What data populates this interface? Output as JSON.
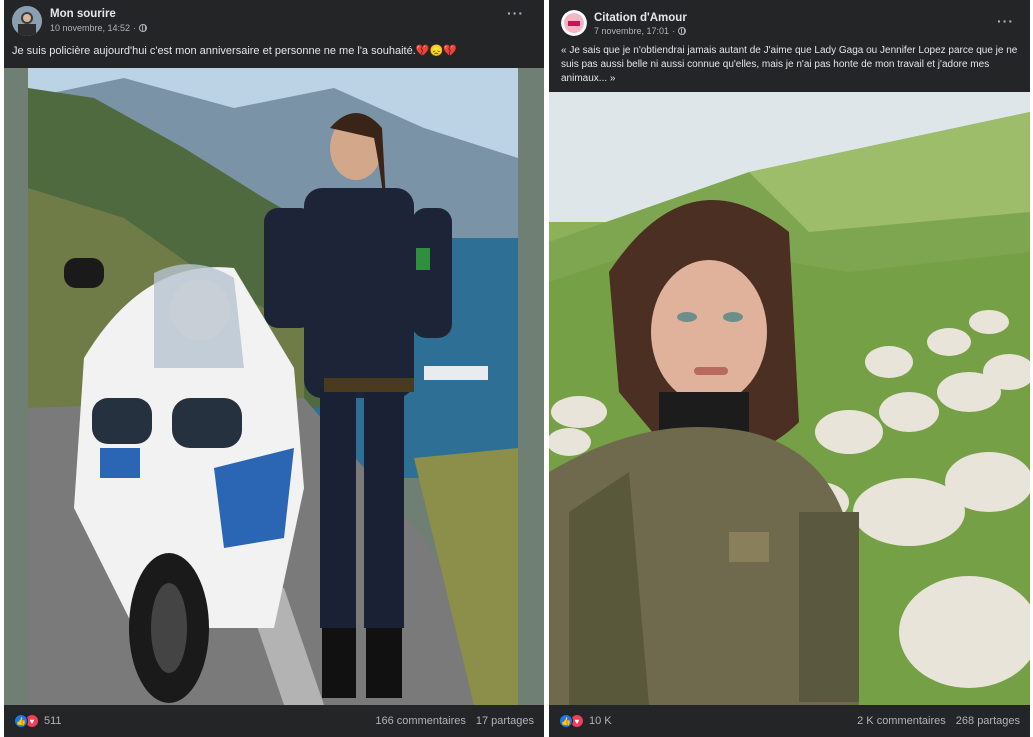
{
  "posts": [
    {
      "author": "Mon sourire",
      "date": "10 novembre, 14:52",
      "separator": "·",
      "text": "Je suis policière aujourd'hui c'est mon anniversaire et personne ne me l'a souhaité.💔😞💔",
      "reaction_count": "511",
      "comments": "166 commentaires",
      "shares": "17 partages",
      "icons": {
        "menu": "more-horizontal-icon",
        "audience": "globe-icon",
        "reactions": [
          "like-icon",
          "love-icon"
        ]
      }
    },
    {
      "author": "Citation d'Amour",
      "date": "7 novembre, 17:01",
      "separator": "·",
      "text": "« Je sais que je n'obtiendrai jamais autant de J'aime que Lady Gaga ou Jennifer Lopez parce que je ne suis pas aussi belle ni aussi connue qu'elles, mais je n'ai pas honte de mon travail et j'adore mes animaux... »",
      "reaction_count": "10 K",
      "comments": "2 K commentaires",
      "shares": "268 partages",
      "icons": {
        "menu": "more-horizontal-icon",
        "audience": "globe-icon",
        "reactions": [
          "like-icon",
          "love-icon"
        ]
      }
    }
  ],
  "colors": {
    "card_bg": "#242526",
    "text": "#e4e6eb",
    "muted": "#b0b3b8",
    "like_blue": "#1877f2",
    "love_red": "#f33e58"
  }
}
